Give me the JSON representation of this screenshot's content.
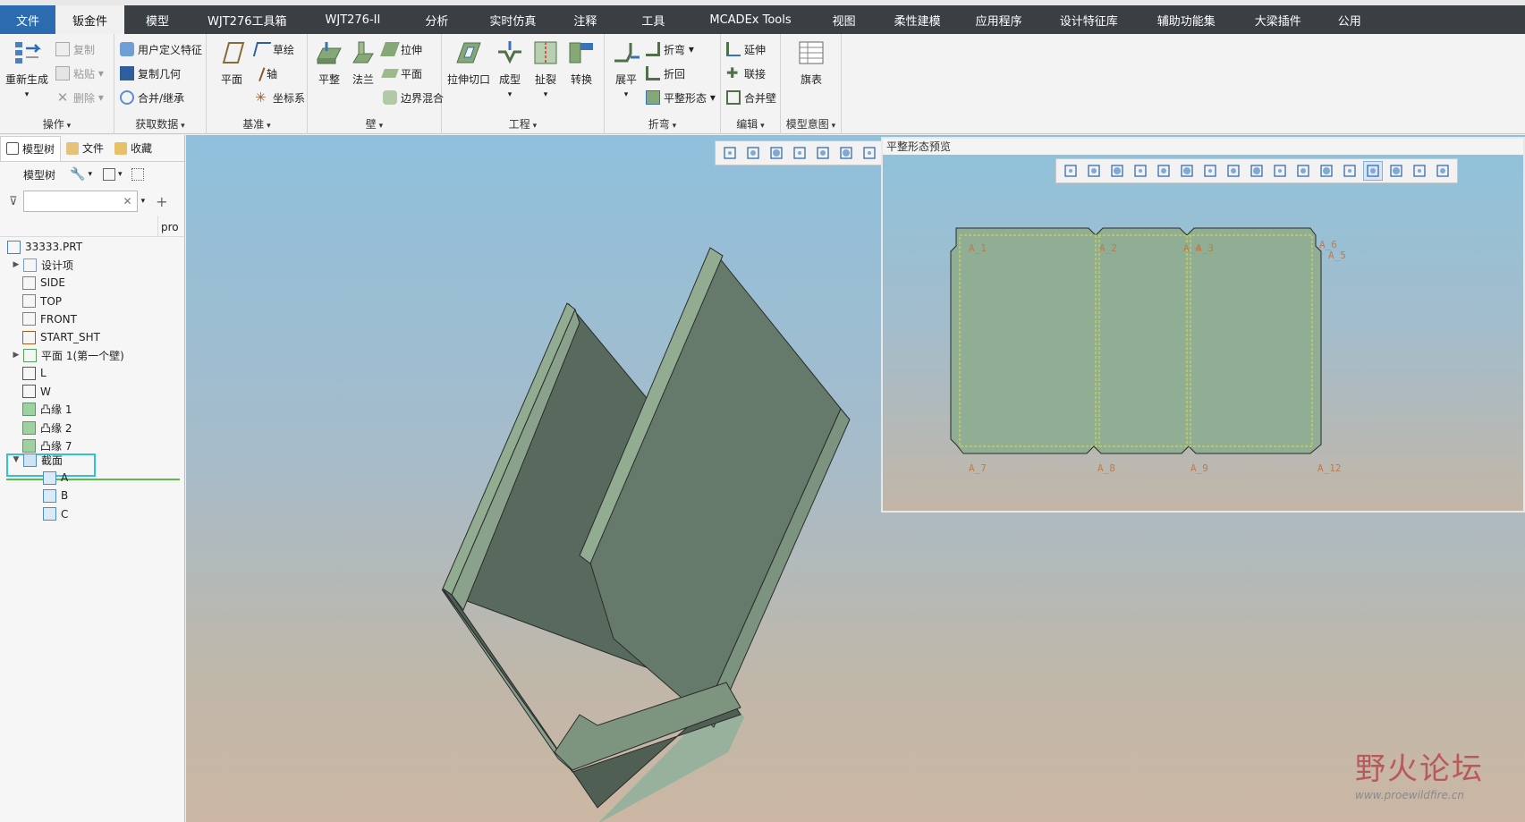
{
  "tabs": [
    "文件",
    "钣金件",
    "模型",
    "WJT276工具箱",
    "WJT276-II",
    "分析",
    "实时仿真",
    "注释",
    "工具",
    "MCADEx Tools",
    "视图",
    "柔性建模",
    "应用程序",
    "设计特征库",
    "辅助功能集",
    "大梁插件",
    "公用"
  ],
  "ribbon": {
    "ops": {
      "regen": "重新生成",
      "copy": "复制",
      "paste": "粘贴",
      "delete": "删除",
      "label": "操作"
    },
    "getdata": {
      "udf": "用户定义特征",
      "copygeom": "复制几何",
      "merge": "合并/继承",
      "label": "获取数据"
    },
    "datum": {
      "plane": "平面",
      "sketch": "草绘",
      "axis": "轴",
      "csys": "坐标系",
      "label": "基准"
    },
    "wall": {
      "flat": "平整",
      "flange": "法兰",
      "extrude": "拉伸",
      "planar": "平面",
      "blend": "边界混合",
      "label": "壁"
    },
    "eng": {
      "cut": "拉伸切口",
      "form": "成型",
      "rip": "扯裂",
      "convert": "转换",
      "label": "工程"
    },
    "bend": {
      "unbend": "展平",
      "bend": "折弯",
      "bendback": "折回",
      "flatform": "平整形态",
      "label": "折弯"
    },
    "edit": {
      "extend": "延伸",
      "join": "联接",
      "mergewall": "合并壁",
      "label": "编辑"
    },
    "intent": {
      "flagtable": "旗表",
      "label": "模型意图"
    }
  },
  "panel": {
    "tabs": [
      "模型树",
      "文件",
      "收藏"
    ],
    "tree_label": "模型树",
    "filter_placeholder": "",
    "col": "pro",
    "items": [
      {
        "label": "33333.PRT",
        "expand": ""
      },
      {
        "label": "设计项",
        "expand": "▶"
      },
      {
        "label": "SIDE",
        "expand": ""
      },
      {
        "label": "TOP",
        "expand": ""
      },
      {
        "label": "FRONT",
        "expand": ""
      },
      {
        "label": "START_SHT",
        "expand": ""
      },
      {
        "label": "平面 1(第一个壁)",
        "expand": "▶"
      },
      {
        "label": "L",
        "expand": ""
      },
      {
        "label": "W",
        "expand": ""
      },
      {
        "label": "凸缘 1",
        "expand": ""
      },
      {
        "label": "凸缘 2",
        "expand": ""
      },
      {
        "label": "凸缘 7",
        "expand": ""
      }
    ],
    "sections": {
      "label": "截面",
      "children": [
        "A",
        "B",
        "C"
      ]
    }
  },
  "preview": {
    "title": "平整形态预览",
    "dims": [
      "A_1",
      "A_2",
      "A_3",
      "A_4",
      "A_6",
      "A_5",
      "A_7",
      "A_8",
      "A_9",
      "A_12"
    ]
  },
  "watermark": {
    "brand": "野火论坛",
    "url": "www.proewildfire.cn"
  },
  "colors": {
    "tabbar": "#3a3f44",
    "file_tab": "#2b6cb0",
    "selection": "#31c3d3",
    "part": "#64786a",
    "flat": "#8fae93"
  }
}
